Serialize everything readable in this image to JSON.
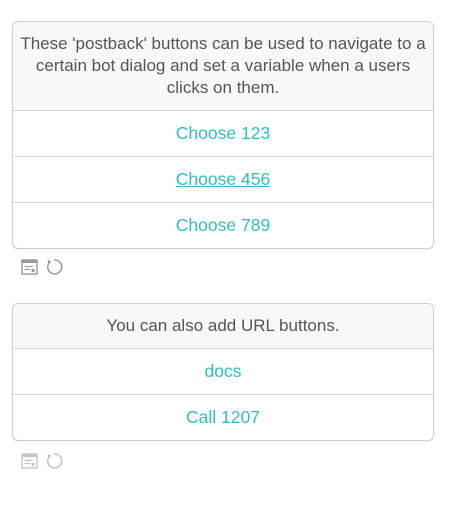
{
  "messages": [
    {
      "text": "These 'postback' buttons can be used to navigate to a certain bot dialog and set a variable when a users clicks on them.",
      "buttons": [
        {
          "label": "Choose 123"
        },
        {
          "label": "Choose 456"
        },
        {
          "label": "Choose 789"
        }
      ],
      "tools": [
        "message-detail-icon",
        "replay-icon"
      ]
    },
    {
      "text": "You can also add URL buttons.",
      "buttons": [
        {
          "label": "docs"
        },
        {
          "label": "Call 1207"
        }
      ],
      "tools": [
        "message-detail-icon",
        "replay-icon"
      ]
    }
  ],
  "colors": {
    "button_text": "#2ebfc6",
    "header_bg": "#f8f8f8",
    "header_text": "#555555",
    "border": "#d7d7d7",
    "tool_icon": "#9a9a9a"
  }
}
